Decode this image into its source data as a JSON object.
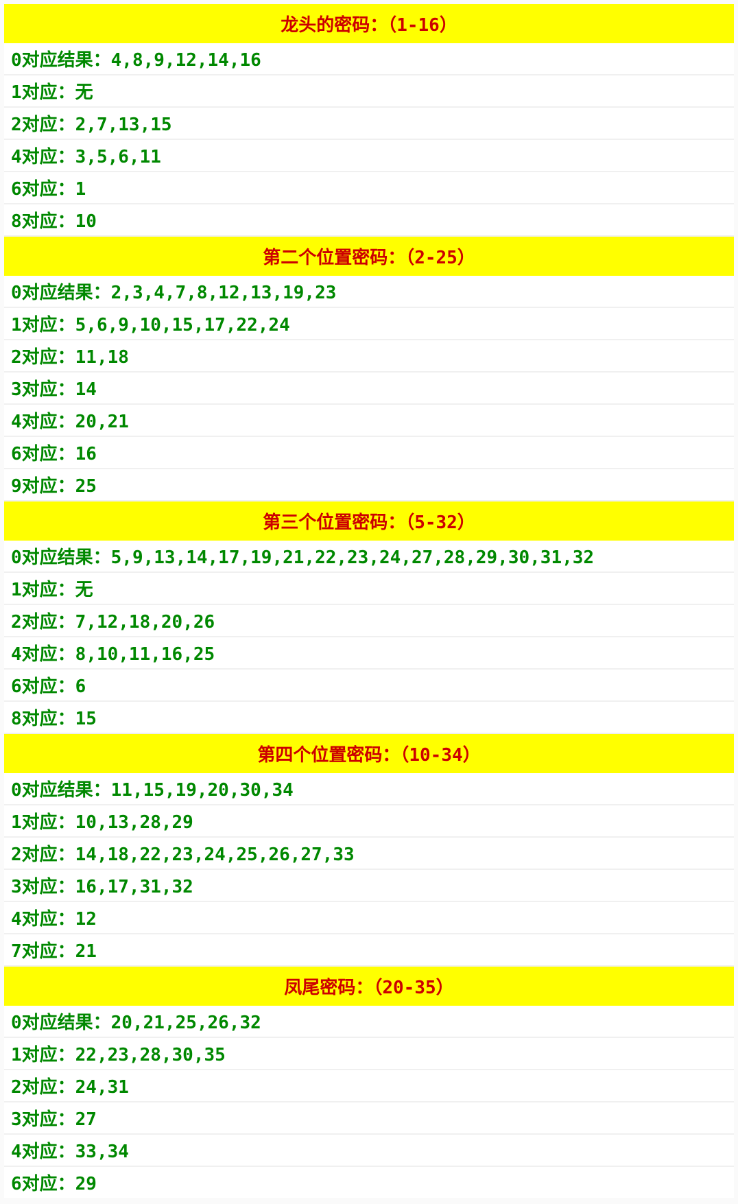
{
  "sections": [
    {
      "title": "龙头的密码：（1-16）",
      "rows": [
        "0对应结果：4,8,9,12,14,16",
        "1对应：无",
        "2对应：2,7,13,15",
        "4对应：3,5,6,11",
        "6对应：1",
        "8对应：10"
      ]
    },
    {
      "title": "第二个位置密码：（2-25）",
      "rows": [
        "0对应结果：2,3,4,7,8,12,13,19,23",
        "1对应：5,6,9,10,15,17,22,24",
        "2对应：11,18",
        "3对应：14",
        "4对应：20,21",
        "6对应：16",
        "9对应：25"
      ]
    },
    {
      "title": "第三个位置密码：（5-32）",
      "rows": [
        "0对应结果：5,9,13,14,17,19,21,22,23,24,27,28,29,30,31,32",
        "1对应：无",
        "2对应：7,12,18,20,26",
        "4对应：8,10,11,16,25",
        "6对应：6",
        "8对应：15"
      ]
    },
    {
      "title": "第四个位置密码：（10-34）",
      "rows": [
        "0对应结果：11,15,19,20,30,34",
        "1对应：10,13,28,29",
        "2对应：14,18,22,23,24,25,26,27,33",
        "3对应：16,17,31,32",
        "4对应：12",
        "7对应：21"
      ]
    },
    {
      "title": "凤尾密码：（20-35）",
      "rows": [
        "0对应结果：20,21,25,26,32",
        "1对应：22,23,28,30,35",
        "2对应：24,31",
        "3对应：27",
        "4对应：33,34",
        "6对应：29"
      ]
    }
  ]
}
